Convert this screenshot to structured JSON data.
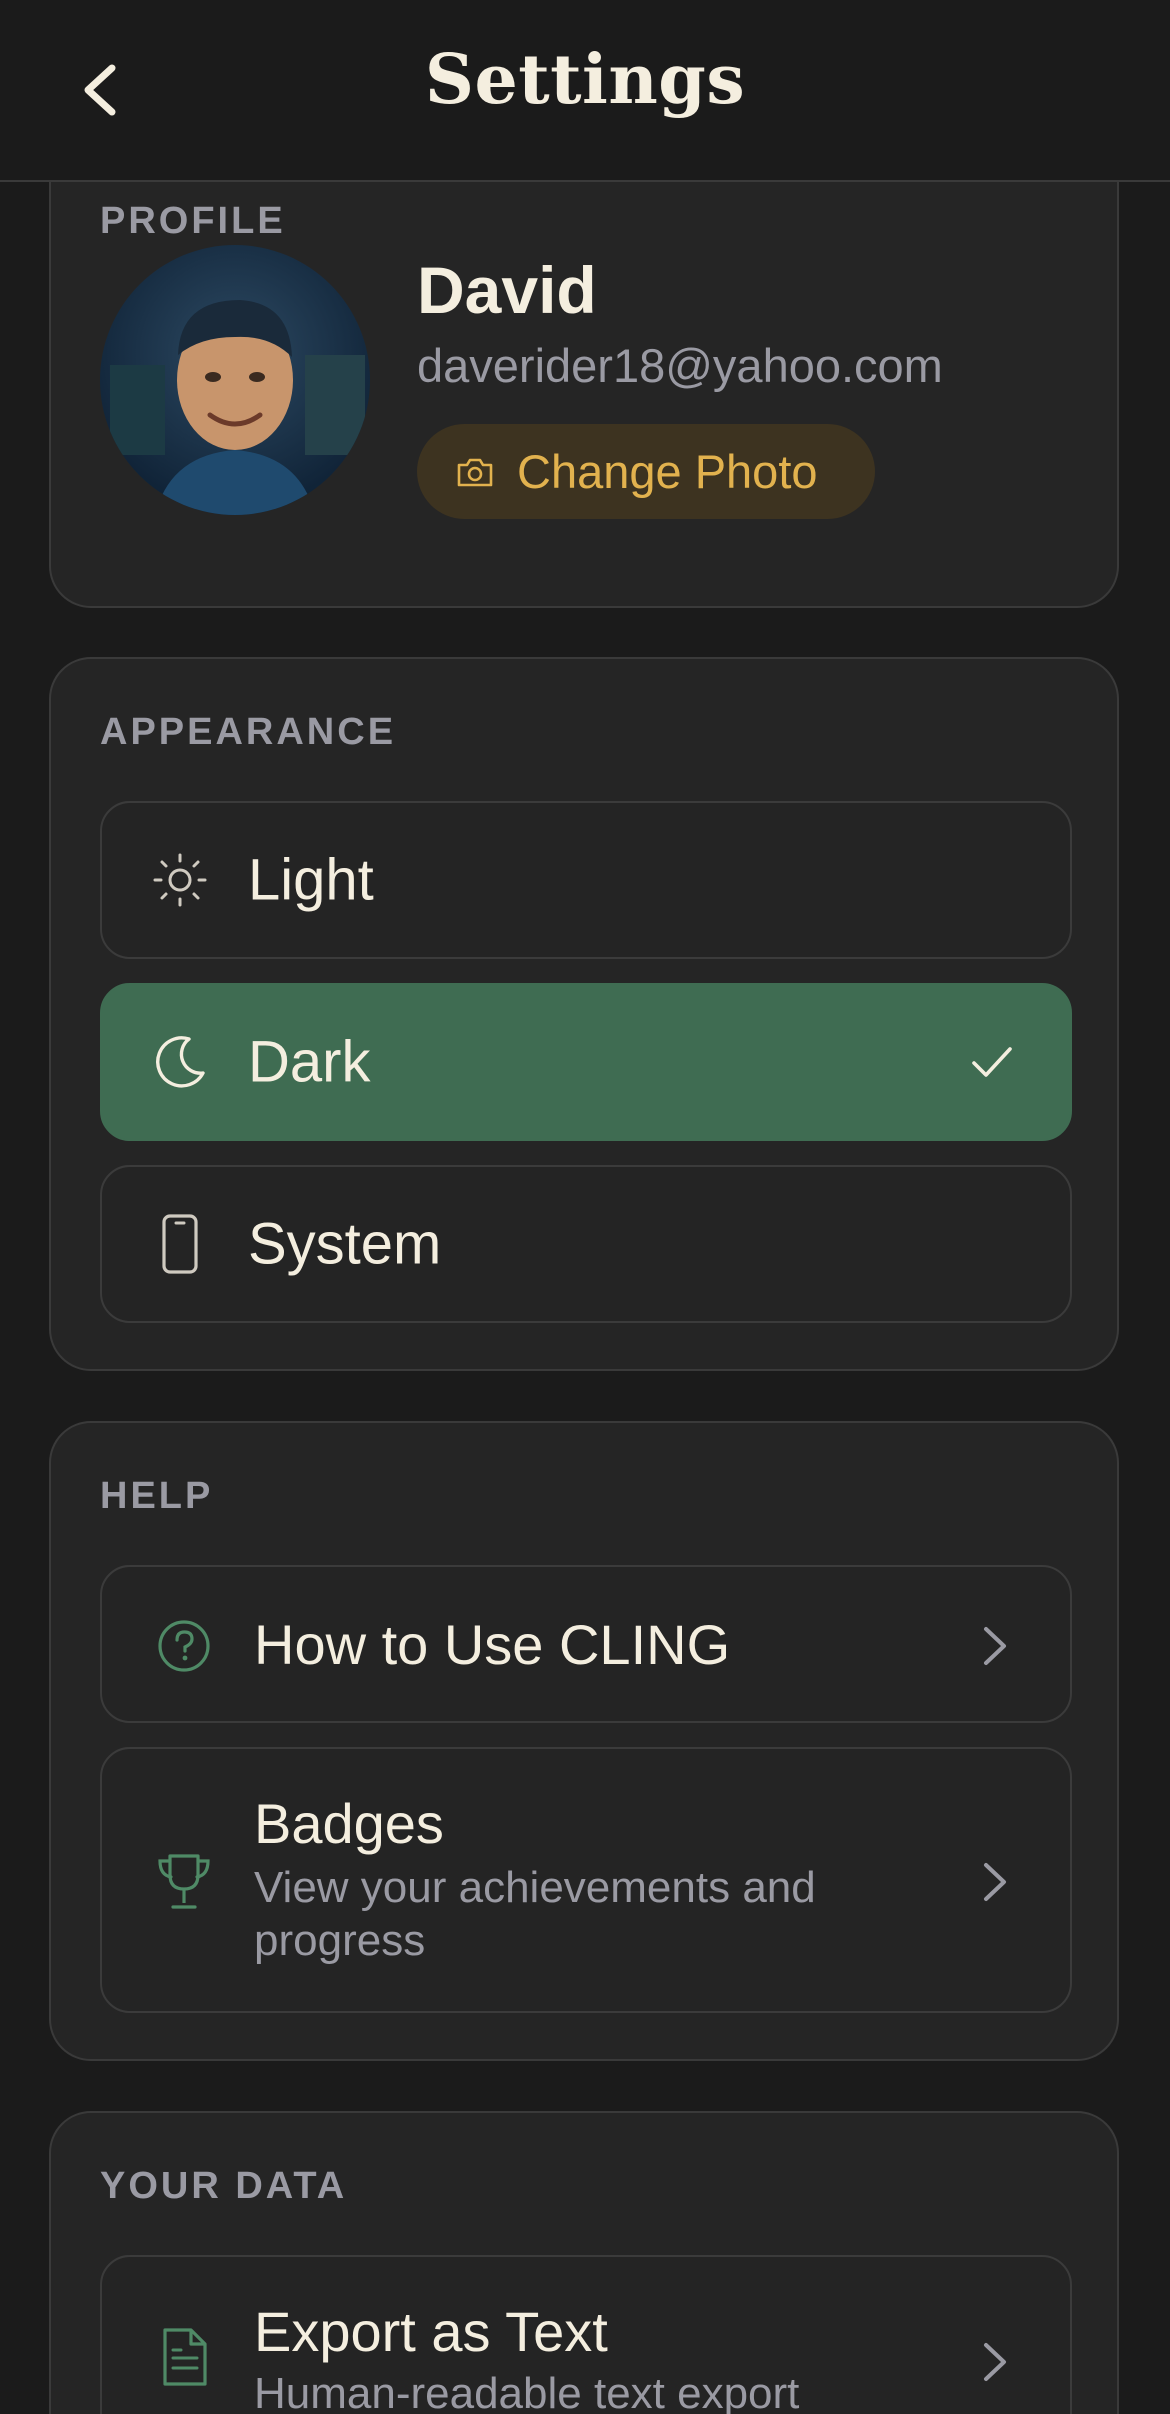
{
  "header": {
    "title": "Settings",
    "back_icon": "chevron-left-icon"
  },
  "profile": {
    "section_label": "PROFILE",
    "name": "David",
    "email": "daverider18@yahoo.com",
    "change_photo_label": "Change Photo",
    "change_photo_icon": "camera-icon"
  },
  "appearance": {
    "section_label": "APPEARANCE",
    "options": [
      {
        "label": "Light",
        "icon": "sun-icon",
        "selected": false
      },
      {
        "label": "Dark",
        "icon": "moon-icon",
        "selected": true
      },
      {
        "label": "System",
        "icon": "phone-icon",
        "selected": false
      }
    ]
  },
  "help": {
    "section_label": "HELP",
    "items": [
      {
        "title": "How to Use CLING",
        "icon": "help-circle-icon"
      },
      {
        "title": "Badges",
        "subtitle": "View your achievements and progress",
        "icon": "trophy-icon"
      }
    ]
  },
  "your_data": {
    "section_label": "YOUR DATA",
    "items": [
      {
        "title": "Export as Text",
        "subtitle": "Human-readable text export",
        "icon": "file-text-icon"
      }
    ]
  },
  "colors": {
    "background": "#1b1b1b",
    "card": "#252525",
    "accent_green": "#3f6c52",
    "accent_gold": "#e2b24e",
    "muted_text": "#9a9aa3"
  }
}
